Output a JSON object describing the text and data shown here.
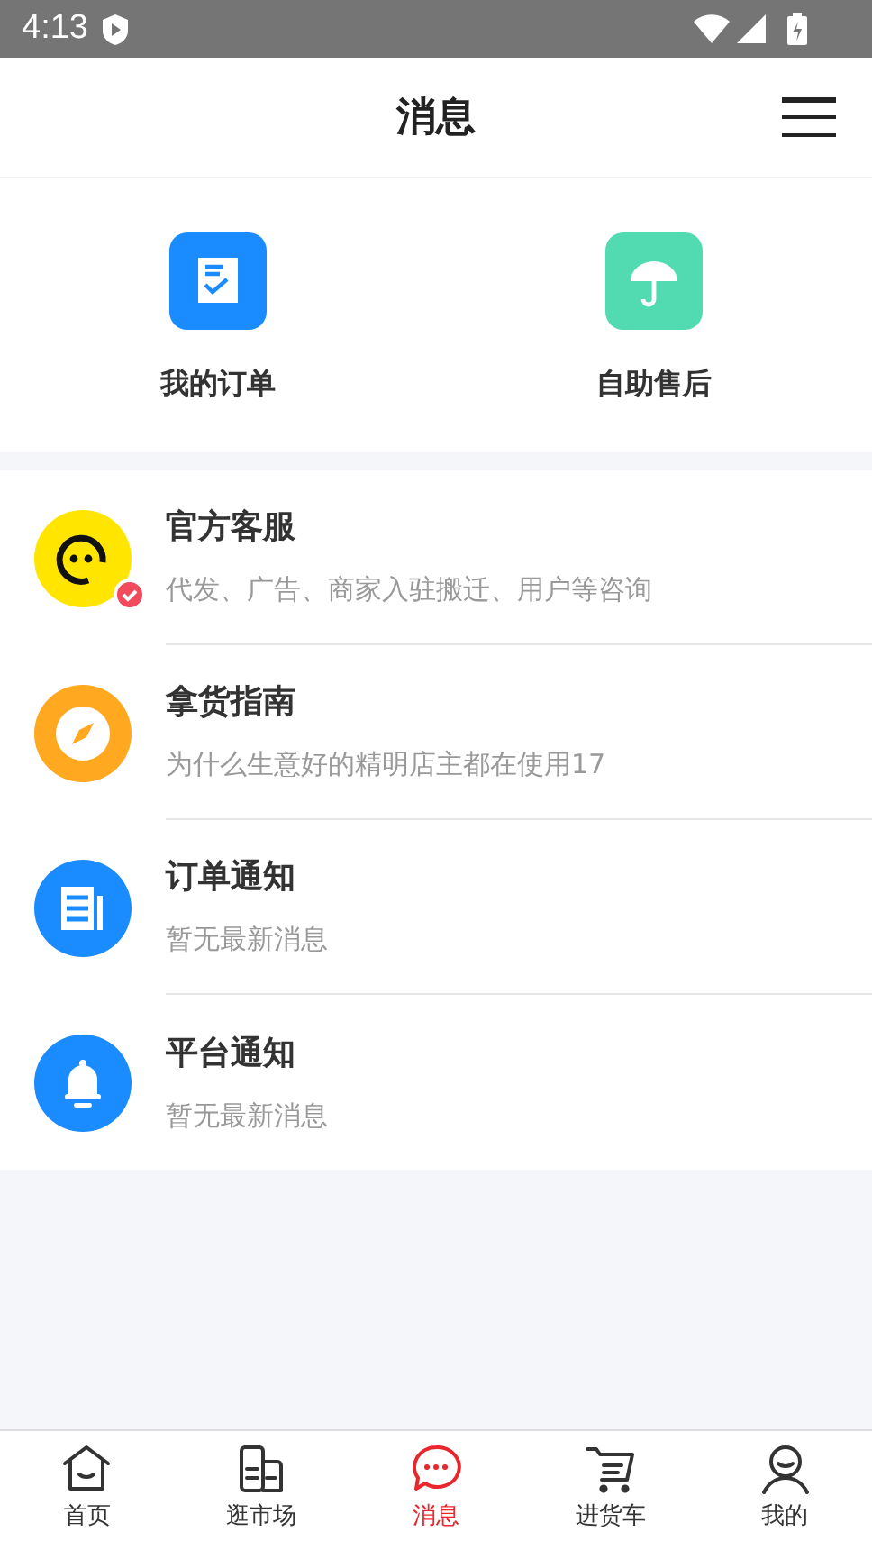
{
  "status_bar": {
    "time": "4:13"
  },
  "header": {
    "title": "消息"
  },
  "shortcuts": [
    {
      "kind": "order",
      "label": "我的订单"
    },
    {
      "kind": "aftersale",
      "label": "自助售后"
    }
  ],
  "messages": [
    {
      "kind": "service",
      "title": "官方客服",
      "subtitle": "代发、广告、商家入驻搬迁、用户等咨询",
      "verified": true
    },
    {
      "kind": "guide",
      "title": "拿货指南",
      "subtitle": "为什么生意好的精明店主都在使用17",
      "verified": false
    },
    {
      "kind": "order",
      "title": "订单通知",
      "subtitle": "暂无最新消息",
      "verified": false
    },
    {
      "kind": "platform",
      "title": "平台通知",
      "subtitle": "暂无最新消息",
      "verified": false
    }
  ],
  "tab_bar": [
    {
      "kind": "home",
      "label": "首页",
      "selected": false
    },
    {
      "kind": "market",
      "label": "逛市场",
      "selected": false
    },
    {
      "kind": "messages",
      "label": "消息",
      "selected": true
    },
    {
      "kind": "cart",
      "label": "进货车",
      "selected": false
    },
    {
      "kind": "profile",
      "label": "我的",
      "selected": false
    }
  ]
}
